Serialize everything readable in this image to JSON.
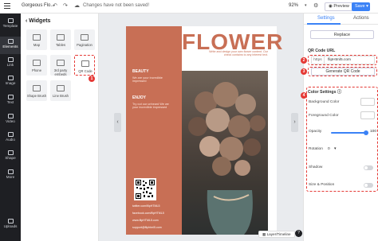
{
  "topbar": {
    "title": "Gorgeous Flo...",
    "undo_icon": "undo-icon",
    "redo_icon": "redo-icon",
    "cloud_icon": "cloud-icon",
    "saved_status": "Changes have not been saved!",
    "zoom": "92%",
    "preview_label": "Preview",
    "save_label": "Save"
  },
  "leftbar": {
    "items": [
      {
        "label": "Template"
      },
      {
        "label": "Elements"
      },
      {
        "label": "Link"
      },
      {
        "label": "Image"
      },
      {
        "label": "Text"
      },
      {
        "label": "Video"
      },
      {
        "label": "Audio"
      },
      {
        "label": "Shape"
      },
      {
        "label": "More"
      }
    ],
    "bottom": {
      "label": "Uploads"
    }
  },
  "widgets_panel": {
    "title": "Widgets",
    "items": [
      {
        "label": "Map"
      },
      {
        "label": "Tables"
      },
      {
        "label": "Pagination"
      },
      {
        "label": "Phone"
      },
      {
        "label": "3rd party embeds"
      },
      {
        "label": "QR Code"
      },
      {
        "label": "Shape Brush"
      },
      {
        "label": "Line Brush"
      }
    ],
    "badge": "1"
  },
  "page": {
    "title": "FLOWER",
    "subtitle": "Write and design your own flower content. Our check contains to any interest text.",
    "sections": [
      {
        "heading": "BEAUTY",
        "body": "We are your incredible impressed"
      },
      {
        "heading": "ENJOY",
        "body": "Try out our unheard We we your incredible impressed"
      }
    ],
    "contacts": [
      "twitter.com/flipHTML5",
      "facebook.com/flipHTML5",
      "www.flipHTML5.com",
      "support@fliphtml5.com"
    ]
  },
  "bottom": {
    "layer_timeline": "Layer/Timeline",
    "help": "?"
  },
  "right_panel": {
    "tabs": [
      {
        "label": "Settings"
      },
      {
        "label": "Actions"
      }
    ],
    "replace_label": "Replace",
    "qr_url_label": "QR Code URL",
    "url_prefix": "https",
    "url_value": "flipHtml5.com",
    "generate_label": "Generate QR Code",
    "color_settings_label": "Color Settings",
    "background_color_label": "Background Color",
    "foreground_color_label": "Foreground Color",
    "opacity_label": "Opacity",
    "opacity_value": "100",
    "rotation_label": "Rotation",
    "rotation_value": "0",
    "shadow_label": "Shadow",
    "size_position_label": "Size & Position",
    "badges": [
      "2",
      "3",
      "4"
    ]
  },
  "colors": {
    "accent": "#3b82f6",
    "brand": "#c86f55",
    "highlight": "#e53935"
  }
}
